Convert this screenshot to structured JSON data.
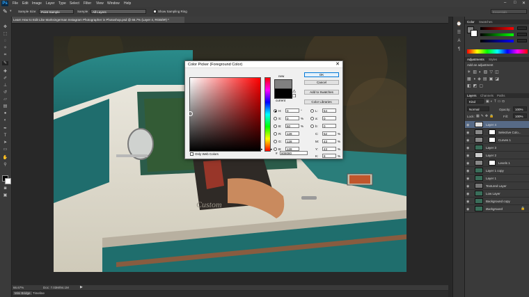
{
  "menubar": {
    "logo": "Ps",
    "items": [
      "File",
      "Edit",
      "Image",
      "Layer",
      "Type",
      "Select",
      "Filter",
      "View",
      "Window",
      "Help"
    ],
    "window_controls": [
      "–",
      "□",
      "✕"
    ]
  },
  "options": {
    "sample_size_label": "Sample Size:",
    "sample_size_value": "Point Sample",
    "sample_label": "Sample:",
    "sample_value": "All Layers",
    "show_ring_label": "Show Sampling Ring",
    "workspace": "Essentials"
  },
  "document": {
    "tab_title": "Learn How to Edit Like Marksingerman Instagram Photographer in Photoshop.psd @ 66.7% (Layer 4, RGB/8#) *",
    "zoom": "66.67%",
    "doc_size": "Doc: 7.03M/94.1M"
  },
  "bottom_tabs": [
    "Mini Bridge",
    "Timeline"
  ],
  "dialog": {
    "title": "Color Picker (Foreground Color)",
    "ok": "OK",
    "cancel": "Cancel",
    "add_swatches": "Add to Swatches",
    "color_libraries": "Color Libraries",
    "new_label": "new",
    "current_label": "current",
    "only_web": "Only Web Colors",
    "new_color": "#808080",
    "current_color": "#000000",
    "fields": {
      "H": {
        "label": "H:",
        "value": "0",
        "unit": "°"
      },
      "S": {
        "label": "S:",
        "value": "0",
        "unit": "%"
      },
      "B": {
        "label": "B:",
        "value": "50",
        "unit": "%"
      },
      "R": {
        "label": "R:",
        "value": "128"
      },
      "G": {
        "label": "G:",
        "value": "128"
      },
      "Bl": {
        "label": "B:",
        "value": "128"
      },
      "L": {
        "label": "L:",
        "value": "54"
      },
      "a": {
        "label": "a:",
        "value": "0"
      },
      "b": {
        "label": "b:",
        "value": "0"
      },
      "C": {
        "label": "C:",
        "value": "52",
        "unit": "%"
      },
      "M": {
        "label": "M:",
        "value": "43",
        "unit": "%"
      },
      "Y": {
        "label": "Y:",
        "value": "43",
        "unit": "%"
      },
      "K": {
        "label": "K:",
        "value": "8",
        "unit": "%"
      },
      "hex_label": "#",
      "hex": "808080"
    }
  },
  "panels": {
    "color_tabs": [
      "Color",
      "Swatches"
    ],
    "adjust_tabs": [
      "Adjustments",
      "Styles"
    ],
    "adjust_hint": "Add an adjustment",
    "layer_tabs": [
      "Layers",
      "Channels",
      "Paths"
    ],
    "kind_label": "Kind",
    "blend_mode": "Normal",
    "opacity_label": "Opacity:",
    "opacity": "100%",
    "lock_label": "Lock:",
    "fill_label": "Fill:",
    "fill": "100%",
    "layers": [
      {
        "name": "Layer 4",
        "selected": true
      },
      {
        "name": "Selective Colo...",
        "adjust": true
      },
      {
        "name": "Curves 1",
        "adjust": true
      },
      {
        "name": "Layer 3"
      },
      {
        "name": "Layer 2"
      },
      {
        "name": "Levels 1",
        "adjust": true
      },
      {
        "name": "Layer 1 copy"
      },
      {
        "name": "Layer 1"
      },
      {
        "name": "Textured Layer"
      },
      {
        "name": "Low Layer"
      },
      {
        "name": "Background copy"
      },
      {
        "name": "Background",
        "locked": true
      }
    ],
    "accent": "#31a8ff"
  }
}
